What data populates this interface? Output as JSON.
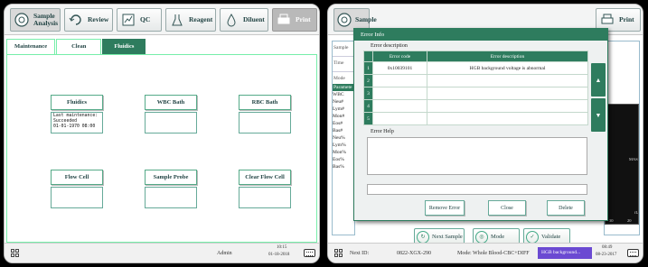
{
  "left": {
    "toolbar": [
      {
        "label_line1": "Sample",
        "label_line2": "Analysis",
        "icon": "sample-analysis-icon"
      },
      {
        "label_line1": "Review",
        "label_line2": "",
        "icon": "review-icon"
      },
      {
        "label_line1": "QC",
        "label_line2": "",
        "icon": "qc-icon"
      },
      {
        "label_line1": "Reagent",
        "label_line2": "",
        "icon": "reagent-icon"
      },
      {
        "label_line1": "Diluent",
        "label_line2": "",
        "icon": "diluent-icon"
      },
      {
        "label_line1": "Print",
        "label_line2": "",
        "icon": "print-icon"
      }
    ],
    "tabs": [
      "Maintenance",
      "Clean",
      "Fluidics"
    ],
    "active_tab": "Fluidics",
    "buttons": [
      "Fluidics",
      "WBC Bath",
      "RBC Bath",
      "Flow Cell",
      "Sample Probe",
      "Clear Flow Cell"
    ],
    "fluidics_info": "Last maintenance:\nSucceeded\n01-01-1970 08:00",
    "status": {
      "user": "Admin",
      "time": "10:15",
      "date": "01-18-2018"
    }
  },
  "right": {
    "toolbar_partial": {
      "sample": "Sample",
      "print": "Print"
    },
    "side_cells": [
      "Sample",
      "Time",
      "Mode"
    ],
    "params_header": "Paramete",
    "params": [
      "WBC",
      "Neu#",
      "Lym#",
      "Mon#",
      "Eos#",
      "Bas#",
      "Neu%",
      "Lym%",
      "Mon%",
      "Eos%",
      "Bas%"
    ],
    "graph_labels": {
      "mas": "MAS",
      "fl": "fL",
      "ticks": [
        "30",
        "20"
      ]
    },
    "dialog": {
      "title": "Error Info",
      "section_desc": "Error description",
      "col_code": "Error code",
      "col_desc": "Error description",
      "rows": [
        {
          "idx": "1",
          "code": "0x10039101",
          "desc": "HGB background voltage is abnormal"
        },
        {
          "idx": "2",
          "code": "",
          "desc": ""
        },
        {
          "idx": "3",
          "code": "",
          "desc": ""
        },
        {
          "idx": "4",
          "code": "",
          "desc": ""
        },
        {
          "idx": "5",
          "code": "",
          "desc": ""
        }
      ],
      "section_help": "Error Help",
      "remove_label": "Remove Error",
      "close_label": "Close",
      "delete_label": "Delete"
    },
    "bottom_buttons": [
      "Next Sample",
      "Mode",
      "Validate"
    ],
    "status": {
      "next_id_label": "Next ID:",
      "next_id_value": "0822-XGX-290",
      "mode_text": "Mode: Whole Blood-CBC+DIFF",
      "error_badge": "HGB background...",
      "time": "08:49",
      "date": "08-23-2017"
    }
  },
  "colors": {
    "accent": "#2e7c5e",
    "badge": "#6b4ad2"
  }
}
